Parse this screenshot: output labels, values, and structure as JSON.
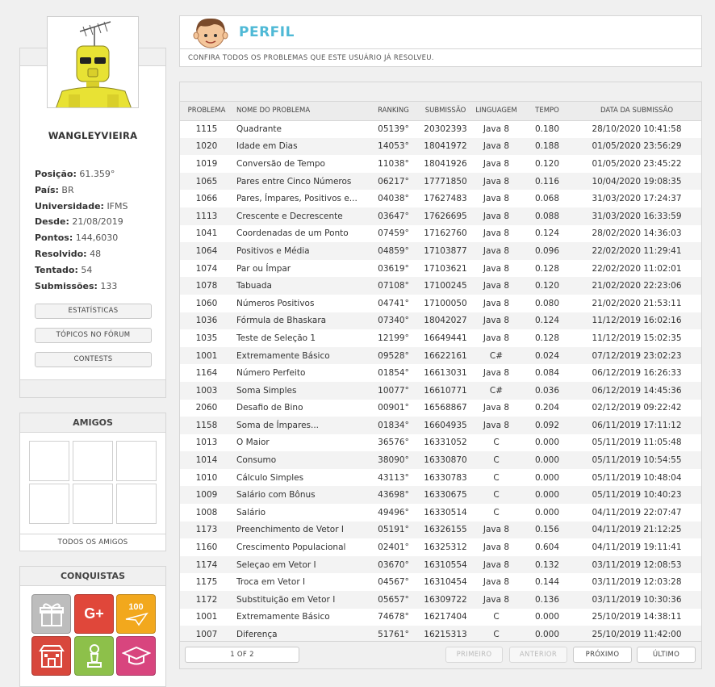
{
  "profile": {
    "username": "WANGLEYVIEIRA",
    "info": [
      {
        "label": "Posição:",
        "value": "61.359°"
      },
      {
        "label": "País:",
        "value": "BR"
      },
      {
        "label": "Universidade:",
        "value": "IFMS"
      },
      {
        "label": "Desde:",
        "value": "21/08/2019"
      },
      {
        "label": "Pontos:",
        "value": "144,6030"
      },
      {
        "label": "Resolvido:",
        "value": "48"
      },
      {
        "label": "Tentado:",
        "value": "54"
      },
      {
        "label": "Submissões:",
        "value": "133"
      }
    ],
    "buttons": [
      "ESTATÍSTICAS",
      "TÓPICOS NO FÓRUM",
      "CONTESTS"
    ]
  },
  "friends": {
    "title": "AMIGOS",
    "footer": "TODOS OS AMIGOS"
  },
  "achievements": {
    "title": "CONQUISTAS",
    "badges": [
      {
        "icon": "gift-icon",
        "color": "#bdbdbd"
      },
      {
        "icon": "google-plus-icon",
        "text": "G+",
        "color": "#e0473a"
      },
      {
        "icon": "paper-plane-100-icon",
        "text": "100",
        "color": "#f2a81d"
      },
      {
        "icon": "building-icon",
        "color": "#d8473c"
      },
      {
        "icon": "chess-pawn-icon",
        "color": "#8dc04a"
      },
      {
        "icon": "graduation-cap-icon",
        "color": "#d8457e"
      }
    ]
  },
  "perfil": {
    "title": "PERFIL",
    "subtitle": "CONFIRA TODOS OS PROBLEMAS QUE ESTE USUÁRIO JÁ RESOLVEU."
  },
  "table": {
    "headers": [
      "PROBLEMA",
      "NOME DO PROBLEMA",
      "RANKING",
      "SUBMISSÃO",
      "LINGUAGEM",
      "TEMPO",
      "DATA DA SUBMISSÃO"
    ],
    "rows": [
      [
        "1115",
        "Quadrante",
        "05139°",
        "20302393",
        "Java 8",
        "0.180",
        "28/10/2020 10:41:58"
      ],
      [
        "1020",
        "Idade em Dias",
        "14053°",
        "18041972",
        "Java 8",
        "0.188",
        "01/05/2020 23:56:29"
      ],
      [
        "1019",
        "Conversão de Tempo",
        "11038°",
        "18041926",
        "Java 8",
        "0.120",
        "01/05/2020 23:45:22"
      ],
      [
        "1065",
        "Pares entre Cinco Números",
        "06217°",
        "17771850",
        "Java 8",
        "0.116",
        "10/04/2020 19:08:35"
      ],
      [
        "1066",
        "Pares, Ímpares, Positivos e...",
        "04038°",
        "17627483",
        "Java 8",
        "0.068",
        "31/03/2020 17:24:37"
      ],
      [
        "1113",
        "Crescente e Decrescente",
        "03647°",
        "17626695",
        "Java 8",
        "0.088",
        "31/03/2020 16:33:59"
      ],
      [
        "1041",
        "Coordenadas de um Ponto",
        "07459°",
        "17162760",
        "Java 8",
        "0.124",
        "28/02/2020 14:36:03"
      ],
      [
        "1064",
        "Positivos e Média",
        "04859°",
        "17103877",
        "Java 8",
        "0.096",
        "22/02/2020 11:29:41"
      ],
      [
        "1074",
        "Par ou Ímpar",
        "03619°",
        "17103621",
        "Java 8",
        "0.128",
        "22/02/2020 11:02:01"
      ],
      [
        "1078",
        "Tabuada",
        "07108°",
        "17100245",
        "Java 8",
        "0.120",
        "21/02/2020 22:23:06"
      ],
      [
        "1060",
        "Números Positivos",
        "04741°",
        "17100050",
        "Java 8",
        "0.080",
        "21/02/2020 21:53:11"
      ],
      [
        "1036",
        "Fórmula de Bhaskara",
        "07340°",
        "18042027",
        "Java 8",
        "0.124",
        "11/12/2019 16:02:16"
      ],
      [
        "1035",
        "Teste de Seleção 1",
        "12199°",
        "16649441",
        "Java 8",
        "0.128",
        "11/12/2019 15:02:35"
      ],
      [
        "1001",
        "Extremamente Básico",
        "09528°",
        "16622161",
        "C#",
        "0.024",
        "07/12/2019 23:02:23"
      ],
      [
        "1164",
        "Número Perfeito",
        "01854°",
        "16613031",
        "Java 8",
        "0.084",
        "06/12/2019 16:26:33"
      ],
      [
        "1003",
        "Soma Simples",
        "10077°",
        "16610771",
        "C#",
        "0.036",
        "06/12/2019 14:45:36"
      ],
      [
        "2060",
        "Desafio de Bino",
        "00901°",
        "16568867",
        "Java 8",
        "0.204",
        "02/12/2019 09:22:42"
      ],
      [
        "1158",
        "Soma de Ímpares...",
        "01834°",
        "16604935",
        "Java 8",
        "0.092",
        "06/11/2019 17:11:12"
      ],
      [
        "1013",
        "O Maior",
        "36576°",
        "16331052",
        "C",
        "0.000",
        "05/11/2019 11:05:48"
      ],
      [
        "1014",
        "Consumo",
        "38090°",
        "16330870",
        "C",
        "0.000",
        "05/11/2019 10:54:55"
      ],
      [
        "1010",
        "Cálculo Simples",
        "43113°",
        "16330783",
        "C",
        "0.000",
        "05/11/2019 10:48:04"
      ],
      [
        "1009",
        "Salário com Bônus",
        "43698°",
        "16330675",
        "C",
        "0.000",
        "05/11/2019 10:40:23"
      ],
      [
        "1008",
        "Salário",
        "49496°",
        "16330514",
        "C",
        "0.000",
        "04/11/2019 22:07:47"
      ],
      [
        "1173",
        "Preenchimento de Vetor I",
        "05191°",
        "16326155",
        "Java 8",
        "0.156",
        "04/11/2019 21:12:25"
      ],
      [
        "1160",
        "Crescimento Populacional",
        "02401°",
        "16325312",
        "Java 8",
        "0.604",
        "04/11/2019 19:11:41"
      ],
      [
        "1174",
        "Seleçao em Vetor I",
        "03670°",
        "16310554",
        "Java 8",
        "0.132",
        "03/11/2019 12:08:53"
      ],
      [
        "1175",
        "Troca em Vetor I",
        "04567°",
        "16310454",
        "Java 8",
        "0.144",
        "03/11/2019 12:03:28"
      ],
      [
        "1172",
        "Substituição em Vetor I",
        "05657°",
        "16309722",
        "Java 8",
        "0.136",
        "03/11/2019 10:30:36"
      ],
      [
        "1001",
        "Extremamente Básico",
        "74678°",
        "16217404",
        "C",
        "0.000",
        "25/10/2019 14:38:11"
      ],
      [
        "1007",
        "Diferença",
        "51761°",
        "16215313",
        "C",
        "0.000",
        "25/10/2019 11:42:00"
      ]
    ]
  },
  "pagination": {
    "page_info": "1 OF 2",
    "first": "PRIMEIRO",
    "previous": "ANTERIOR",
    "next": "PRÓXIMO",
    "last": "ÚLTIMO"
  }
}
